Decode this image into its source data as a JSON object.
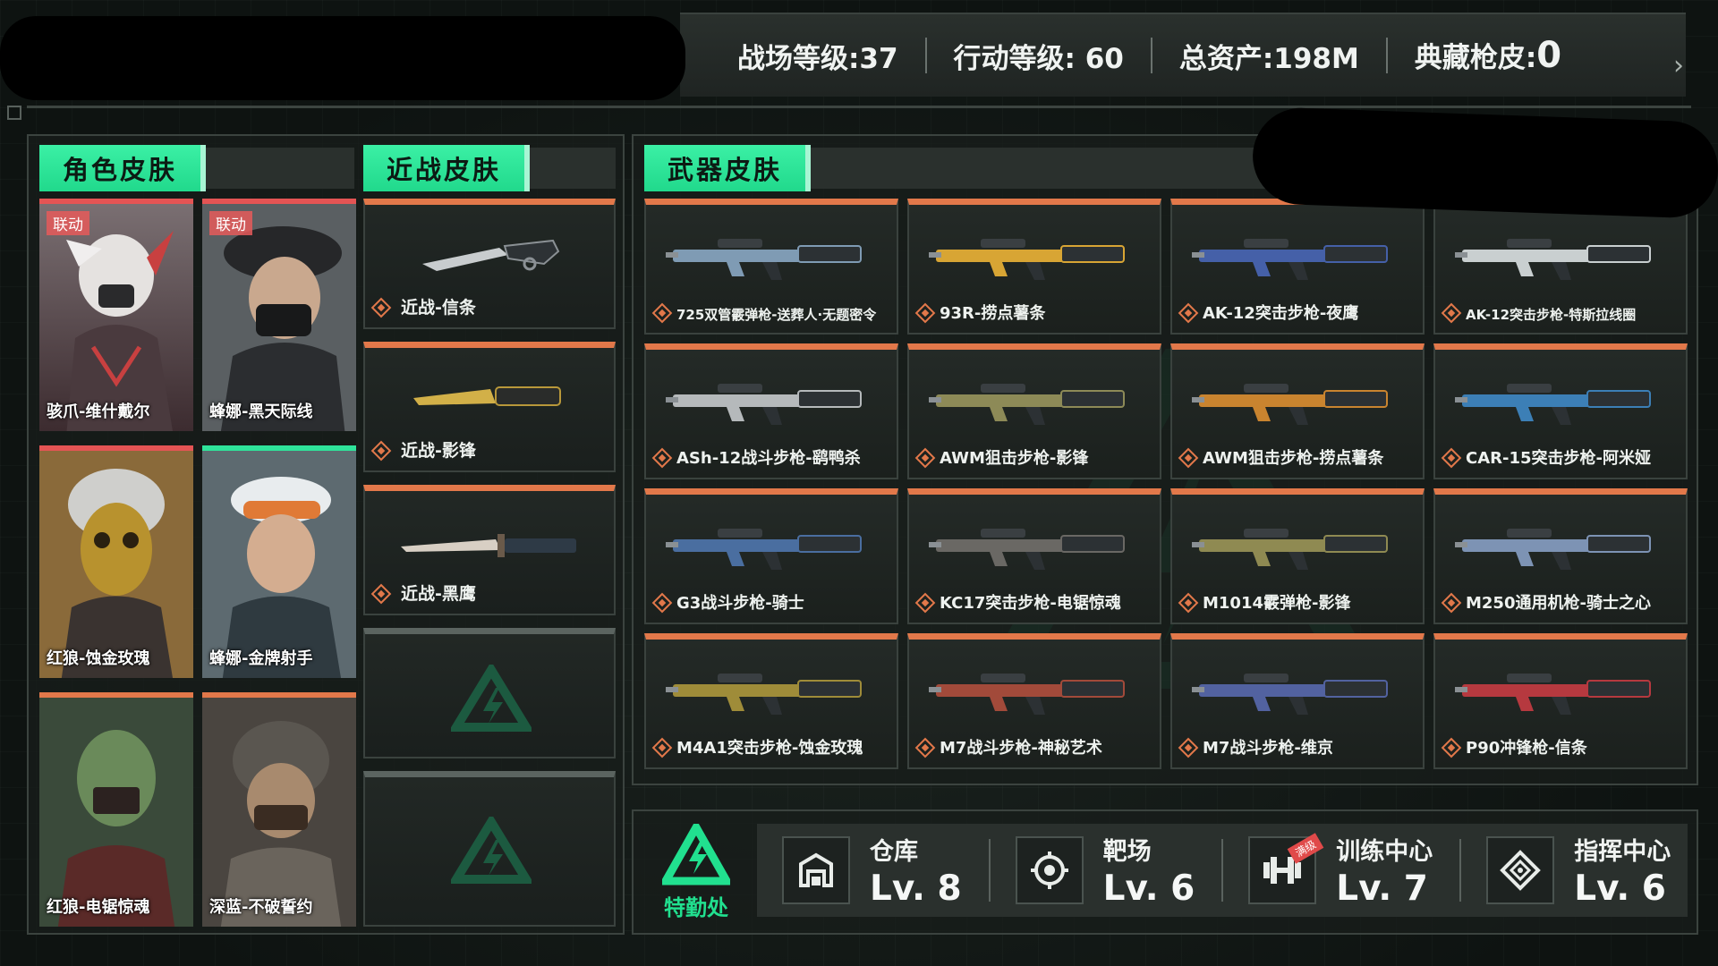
{
  "top_stats": {
    "battlefield_level": "战场等级:37",
    "operation_level": "行动等级: 60",
    "total_assets": "总资产:198M",
    "collection_skins_label": "典藏枪皮:",
    "collection_skins_value": "0"
  },
  "tabs": {
    "character": "角色皮肤",
    "melee": "近战皮肤",
    "weapon": "武器皮肤"
  },
  "character_skins": [
    {
      "name": "骇爪-维什戴尔",
      "badge": "联动",
      "color": "#b23a3a"
    },
    {
      "name": "蜂娜-黑天际线",
      "badge": "联动",
      "color": "#b23a3a"
    },
    {
      "name": "红狼-蚀金玫瑰",
      "badge": "",
      "color": "#b23a3a"
    },
    {
      "name": "蜂娜-金牌射手",
      "badge": "",
      "color": "#2fe39a"
    },
    {
      "name": "红狼-电锯惊魂",
      "badge": "",
      "color": "#e2784a"
    },
    {
      "name": "深蓝-不破誓约",
      "badge": "",
      "color": "#e2784a"
    }
  ],
  "melee_skins": [
    {
      "name": "近战-信条"
    },
    {
      "name": "近战-影锋"
    },
    {
      "name": "近战-黑鹰"
    }
  ],
  "weapon_skins": [
    {
      "name": "725双管霰弹枪-送葬人·无题密令",
      "tint": "#7f9bb4"
    },
    {
      "name": "93R-捞点薯条",
      "tint": "#d8a534"
    },
    {
      "name": "AK-12突击步枪-夜鹰",
      "tint": "#4560a8"
    },
    {
      "name": "AK-12突击步枪-特斯拉线圈",
      "tint": "#c9cfd0"
    },
    {
      "name": "ASh-12战斗步枪-鹞鸭杀",
      "tint": "#b5b9bb"
    },
    {
      "name": "AWM狙击步枪-影锋",
      "tint": "#8d8a57"
    },
    {
      "name": "AWM狙击步枪-捞点薯条",
      "tint": "#c9842f"
    },
    {
      "name": "CAR-15突击步枪-阿米娅",
      "tint": "#3c7fb6"
    },
    {
      "name": "G3战斗步枪-骑士",
      "tint": "#4a6ea0"
    },
    {
      "name": "KC17突击步枪-电锯惊魂",
      "tint": "#6a6864"
    },
    {
      "name": "M1014霰弹枪-影锋",
      "tint": "#8f8a52"
    },
    {
      "name": "M250通用机枪-骑士之心",
      "tint": "#7d93b4"
    },
    {
      "name": "M4A1突击步枪-蚀金玫瑰",
      "tint": "#9f8c39"
    },
    {
      "name": "M7战斗步枪-神秘艺术",
      "tint": "#a24a3a"
    },
    {
      "name": "M7战斗步枪-维京",
      "tint": "#5262a0"
    },
    {
      "name": "P90冲锋枪-信条",
      "tint": "#b6393f"
    }
  ],
  "bottom": {
    "logo_text": "特勤处",
    "facilities": [
      {
        "name": "仓库",
        "level": "Lv. 8",
        "icon": "warehouse-icon"
      },
      {
        "name": "靶场",
        "level": "Lv. 6",
        "icon": "target-icon"
      },
      {
        "name": "训练中心",
        "level": "Lv. 7",
        "icon": "dumbbell-icon",
        "badge": "满级"
      },
      {
        "name": "指挥中心",
        "level": "Lv. 6",
        "icon": "command-icon"
      }
    ]
  },
  "colors": {
    "accent_green": "#21e08f",
    "accent_orange": "#e2784a",
    "accent_red": "#e45454"
  }
}
